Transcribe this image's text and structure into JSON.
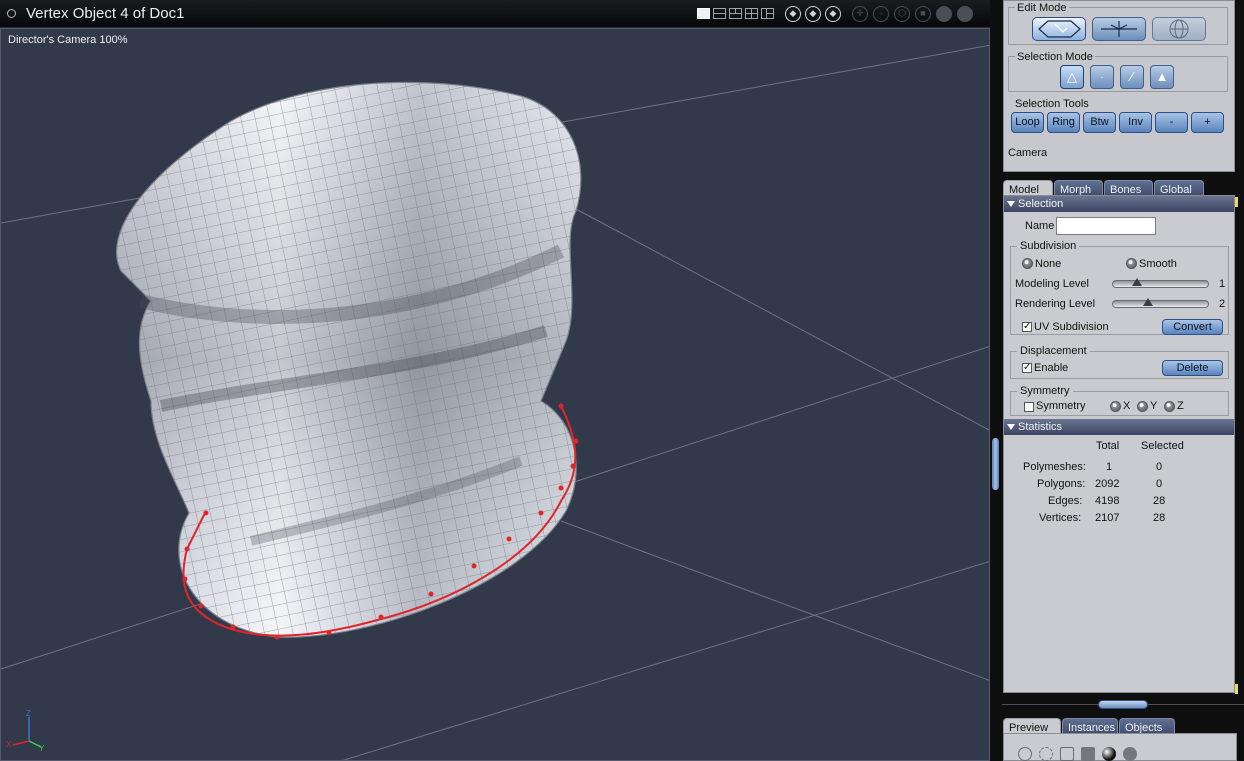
{
  "window": {
    "title": "Vertex Object 4 of Doc1"
  },
  "viewport": {
    "camera_label": "Director's Camera 100%"
  },
  "axis": {
    "x": "X",
    "y": "Y",
    "z": "Z"
  },
  "edit_mode": {
    "label": "Edit Mode"
  },
  "selection_mode": {
    "label": "Selection Mode"
  },
  "selection_tools": {
    "label": "Selection Tools",
    "buttons": [
      "Loop",
      "Ring",
      "Btw",
      "Inv",
      "-",
      "+"
    ]
  },
  "camera_label": "Camera",
  "tabs": [
    "Model",
    "Morph",
    "Bones",
    "Global"
  ],
  "selection": {
    "header": "Selection",
    "name_label": "Name",
    "name_value": ""
  },
  "subdivision": {
    "label": "Subdivision",
    "none": "None",
    "smooth": "Smooth",
    "modeling_label": "Modeling Level",
    "modeling_value": "1",
    "rendering_label": "Rendering Level",
    "rendering_value": "2",
    "uv_label": "UV Subdivision",
    "convert": "Convert"
  },
  "displacement": {
    "label": "Displacement",
    "enable": "Enable",
    "delete": "Delete"
  },
  "symmetry": {
    "label": "Symmetry",
    "check": "Symmetry",
    "x": "X",
    "y": "Y",
    "z": "Z"
  },
  "statistics": {
    "header": "Statistics",
    "col_total": "Total",
    "col_selected": "Selected",
    "rows": [
      {
        "label": "Polymeshes:",
        "total": "1",
        "selected": "0"
      },
      {
        "label": "Polygons:",
        "total": "2092",
        "selected": "0"
      },
      {
        "label": "Edges:",
        "total": "4198",
        "selected": "28"
      },
      {
        "label": "Vertices:",
        "total": "2107",
        "selected": "28"
      }
    ]
  },
  "bottom_tabs": [
    "Preview",
    "Instances",
    "Objects"
  ],
  "colors": {
    "viewport_bg": "#32394a",
    "panel_bg": "#c9cbd0",
    "selection": "#e0262a",
    "button": "#5a84bd"
  }
}
